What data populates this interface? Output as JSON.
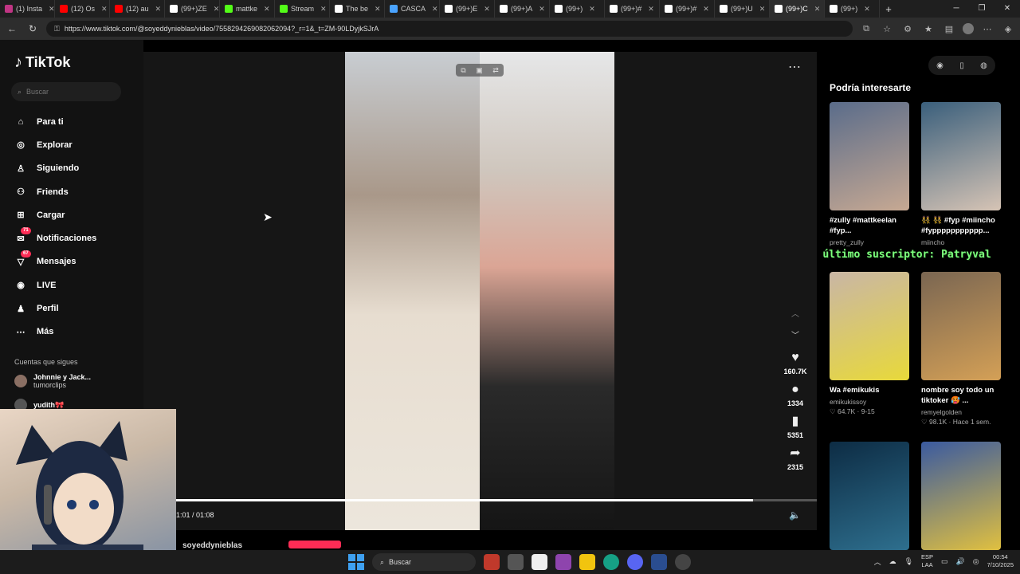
{
  "browser": {
    "tabs": [
      {
        "label": "(1) Insta",
        "color": "#c13584"
      },
      {
        "label": "(12) Os",
        "color": "#ff0000"
      },
      {
        "label": "(12) au",
        "color": "#ff0000"
      },
      {
        "label": "(99+)ZE",
        "color": "#ffffff"
      },
      {
        "label": "mattke",
        "color": "#53fc18"
      },
      {
        "label": "Stream",
        "color": "#53fc18"
      },
      {
        "label": "The be",
        "color": "#ffffff"
      },
      {
        "label": "CASCA",
        "color": "#4aa3ff"
      },
      {
        "label": "(99+)E",
        "color": "#ffffff"
      },
      {
        "label": "(99+)A",
        "color": "#ffffff"
      },
      {
        "label": "(99+)",
        "color": "#ffffff"
      },
      {
        "label": "(99+)#",
        "color": "#ffffff"
      },
      {
        "label": "(99+)#",
        "color": "#ffffff"
      },
      {
        "label": "(99+)U",
        "color": "#ffffff"
      },
      {
        "label": "(99+)C",
        "color": "#ffffff"
      },
      {
        "label": "(99+)",
        "color": "#ffffff"
      }
    ],
    "new_tab": "+",
    "url": "https://www.tiktok.com/@soyeddynieblas/video/7558294269082062094?_r=1&_t=ZM-90LDyjkSJrA"
  },
  "sidebar": {
    "logo": "TikTok",
    "search_placeholder": "Buscar",
    "items": [
      {
        "label": "Para ti",
        "icon": "home-icon"
      },
      {
        "label": "Explorar",
        "icon": "compass-icon"
      },
      {
        "label": "Siguiendo",
        "icon": "following-icon"
      },
      {
        "label": "Friends",
        "icon": "friends-icon"
      },
      {
        "label": "Cargar",
        "icon": "upload-icon"
      },
      {
        "label": "Notificaciones",
        "icon": "bell-icon",
        "badge": "71"
      },
      {
        "label": "Mensajes",
        "icon": "message-icon",
        "badge": "67"
      },
      {
        "label": "LIVE",
        "icon": "live-icon"
      },
      {
        "label": "Perfil",
        "icon": "profile-icon"
      },
      {
        "label": "Más",
        "icon": "more-icon"
      }
    ],
    "following_title": "Cuentas que sigues",
    "following": [
      {
        "name": "Johnnie y Jack...",
        "sub": "tumorclips"
      },
      {
        "name": "yudith🎀",
        "sub": ""
      }
    ]
  },
  "video": {
    "time": "1:01 / 01:08",
    "progress": 0.9,
    "username": "soyeddynieblas",
    "likes": "160.7K",
    "comments": "1334",
    "saves": "5351",
    "shares": "2315"
  },
  "recommendations": {
    "title": "Podría interesarte",
    "overlay": "último suscriptor: Patryval",
    "cards": [
      {
        "caption": "#zully #mattkeelan #fyp...",
        "author": "pretty_zully",
        "meta": "",
        "colors": [
          "#5a6c8a",
          "#c7a993"
        ]
      },
      {
        "caption": "👯 👯 #fyp #miincho #fyppppppppppp...",
        "author": "miincho",
        "meta": "",
        "colors": [
          "#3a5f7c",
          "#d6c4b5"
        ]
      },
      {
        "caption": "Wa #emikukis",
        "author": "emikukissoy",
        "meta": "♡ 64.7K · 9-15",
        "colors": [
          "#c9b6a5",
          "#e8d93a"
        ]
      },
      {
        "caption": "nombre soy todo un tiktoker 🥵 ...",
        "author": "remyelgolden",
        "meta": "♡ 98.1K · Hace 1 sem.",
        "colors": [
          "#7a6652",
          "#d4a056"
        ]
      },
      {
        "caption": "",
        "author": "",
        "meta": "",
        "colors": [
          "#0d2c44",
          "#2e6f8e"
        ]
      },
      {
        "caption": "",
        "author": "",
        "meta": "",
        "colors": [
          "#3a5aa0",
          "#e0c040"
        ]
      }
    ]
  },
  "taskbar": {
    "search": "Buscar",
    "lang_top": "ESP",
    "lang_bottom": "LAA",
    "time": "00:54",
    "date": "7/10/2025"
  }
}
